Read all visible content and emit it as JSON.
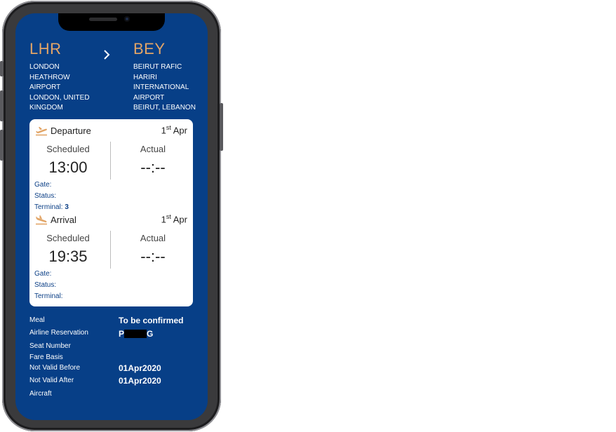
{
  "route": {
    "from_code": "LHR",
    "from_airport": [
      "LONDON",
      "HEATHROW",
      "AIRPORT",
      "LONDON, UNITED",
      "KINGDOM"
    ],
    "to_code": "BEY",
    "to_airport": [
      "BEIRUT RAFIC",
      "HARIRI",
      "INTERNATIONAL",
      "AIRPORT",
      "BEIRUT, LEBANON"
    ]
  },
  "departure": {
    "title": "Departure",
    "date_day": "1",
    "date_suffix": "st",
    "date_month": "Apr",
    "scheduled_label": "Scheduled",
    "scheduled_time": "13:00",
    "actual_label": "Actual",
    "actual_time": "--:--",
    "gate_label": "Gate:",
    "status_label": "Status:",
    "terminal_label": "Terminal:",
    "terminal_value": "3"
  },
  "arrival": {
    "title": "Arrival",
    "date_day": "1",
    "date_suffix": "st",
    "date_month": "Apr",
    "scheduled_label": "Scheduled",
    "scheduled_time": "19:35",
    "actual_label": "Actual",
    "actual_time": "--:--",
    "gate_label": "Gate:",
    "status_label": "Status:",
    "terminal_label": "Terminal:"
  },
  "details": {
    "meal_label": "Meal",
    "meal_value": "To be confirmed",
    "reservation_label": "Airline Reservation",
    "reservation_prefix": "P",
    "reservation_suffix": "G",
    "seat_label": "Seat Number",
    "fare_label": "Fare Basis",
    "nvb_label": "Not Valid Before",
    "nvb_value": "01Apr2020",
    "nva_label": "Not Valid After",
    "nva_value": "01Apr2020",
    "aircraft_label": "Aircraft"
  },
  "colors": {
    "screen_bg": "#073f87",
    "accent": "#e2a567",
    "info_text": "#0b3f86"
  }
}
